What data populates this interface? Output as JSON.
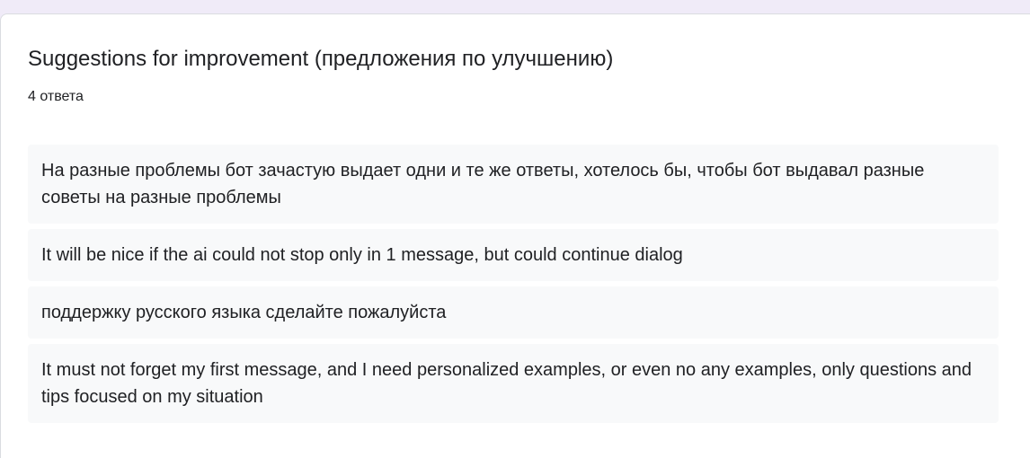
{
  "question": {
    "title": "Suggestions for improvement (предложения по улучшению)",
    "response_count": "4 ответа"
  },
  "responses": [
    "На разные проблемы бот зачастую выдает одни и те же ответы, хотелось бы, чтобы бот выдавал разные советы на разные проблемы",
    "It will be nice if the ai could not stop only in 1 message, but could continue dialog",
    "поддержку русского языка сделайте пожалуйста",
    "It must not forget my first message, and I need personalized examples, or even no any examples, only questions and tips focused on my situation"
  ],
  "colors": {
    "page_background": "#f0ebf8",
    "card_background": "#ffffff",
    "response_background": "#f8f9fa",
    "text": "#202124"
  }
}
